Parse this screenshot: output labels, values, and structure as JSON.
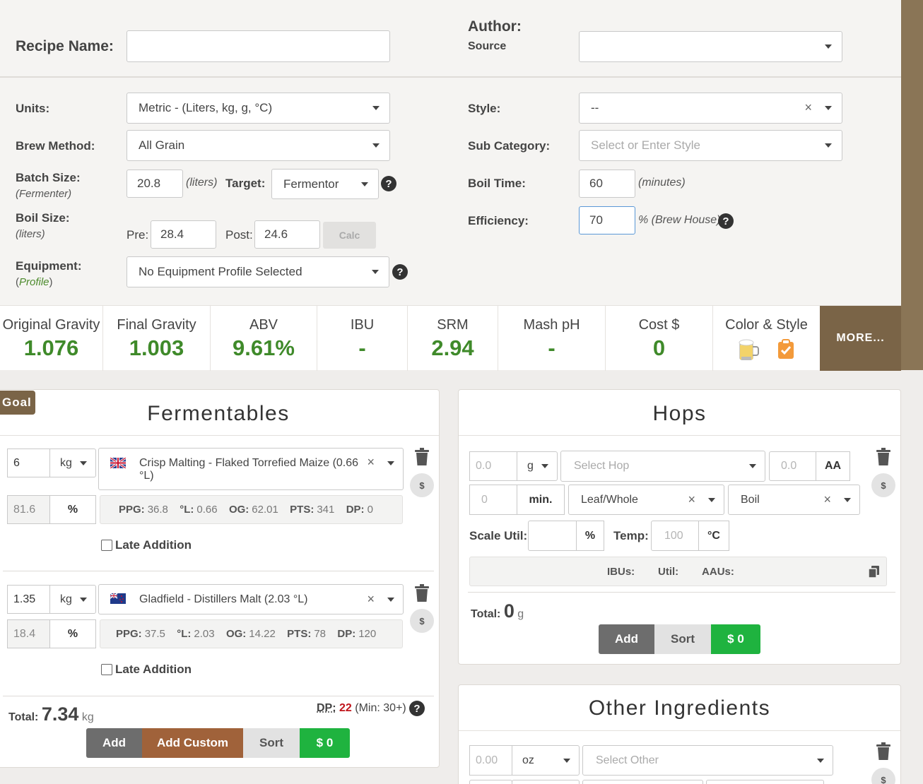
{
  "recipe": {
    "name_label": "Recipe Name:",
    "name_value": "",
    "author_label": "Author:",
    "source_label": "Source",
    "author_value": ""
  },
  "settings": {
    "units_label": "Units:",
    "units_value": "Metric - (Liters, kg, g, °C)",
    "brew_method_label": "Brew Method:",
    "brew_method_value": "All Grain",
    "batch_size_label": "Batch Size:",
    "batch_size_sub": "(Fermenter)",
    "batch_size_value": "20.8",
    "batch_size_unit": "(liters)",
    "target_label": "Target:",
    "target_value": "Fermentor",
    "boil_size_label": "Boil Size:",
    "boil_size_sub": "(liters)",
    "pre_label": "Pre:",
    "pre_value": "28.4",
    "post_label": "Post:",
    "post_value": "24.6",
    "calc_label": "Calc",
    "equipment_label": "Equipment:",
    "equipment_sub_open": "(",
    "equipment_sub_link": "Profile",
    "equipment_sub_close": ")",
    "equipment_value": "No Equipment Profile Selected",
    "style_label": "Style:",
    "style_value": "--",
    "subcat_label": "Sub Category:",
    "subcat_placeholder": "Select or Enter Style",
    "boil_time_label": "Boil Time:",
    "boil_time_value": "60",
    "boil_time_unit": "(minutes)",
    "efficiency_label": "Efficiency:",
    "efficiency_value": "70",
    "efficiency_unit": "% (Brew House)",
    "help_glyph": "?"
  },
  "stats": {
    "og_label": "Original Gravity",
    "og_value": "1.076",
    "fg_label": "Final Gravity",
    "fg_value": "1.003",
    "abv_label": "ABV",
    "abv_value": "9.61%",
    "ibu_label": "IBU",
    "ibu_value": "-",
    "srm_label": "SRM",
    "srm_value": "2.94",
    "ph_label": "Mash pH",
    "ph_value": "-",
    "cost_label": "Cost $",
    "cost_value": "0",
    "color_label": "Color & Style",
    "more_label": "MORE..."
  },
  "fermentables": {
    "goal_tab": "Goal",
    "title": "Fermentables",
    "items": [
      {
        "amount": "6",
        "unit": "kg",
        "name": "Crisp Malting - Flaked Torrefied Maize (0.66",
        "name_cont": "°L)",
        "flag": "uk",
        "pct": "81.6",
        "pct_sign": "%",
        "ppg_label": "PPG:",
        "ppg": "36.8",
        "l_label": "°L:",
        "l": "0.66",
        "og_label": "OG:",
        "og": "62.01",
        "pts_label": "PTS:",
        "pts": "341",
        "dp_label": "DP:",
        "dp": "0",
        "late_label": "Late Addition"
      },
      {
        "amount": "1.35",
        "unit": "kg",
        "name": "Gladfield - Distillers Malt (2.03 °L)",
        "name_cont": "",
        "flag": "nz",
        "pct": "18.4",
        "pct_sign": "%",
        "ppg_label": "PPG:",
        "ppg": "37.5",
        "l_label": "°L:",
        "l": "2.03",
        "og_label": "OG:",
        "og": "14.22",
        "pts_label": "PTS:",
        "pts": "78",
        "dp_label": "DP:",
        "dp": "120",
        "late_label": "Late Addition"
      }
    ],
    "total_label": "Total:",
    "total_value": "7.34",
    "total_unit": "kg",
    "dp_label": "DP:",
    "dp_value": "22",
    "dp_min": "(Min: 30+)",
    "add_label": "Add",
    "add_custom_label": "Add Custom",
    "sort_label": "Sort",
    "cost_label": "$ 0",
    "dollar_glyph": "$",
    "clear_glyph": "×"
  },
  "hops": {
    "title": "Hops",
    "amount_placeholder": "0.0",
    "amount_unit": "g",
    "hop_placeholder": "Select Hop",
    "aa_placeholder": "0.0",
    "aa_label": "AA",
    "time_placeholder": "0",
    "time_unit": "min.",
    "form_value": "Leaf/Whole",
    "use_value": "Boil",
    "scale_label": "Scale Util:",
    "scale_value": "",
    "scale_unit": "%",
    "temp_label": "Temp:",
    "temp_placeholder": "100",
    "temp_unit": "°C",
    "ibus_label": "IBUs:",
    "util_label": "Util:",
    "aaus_label": "AAUs:",
    "total_label": "Total:",
    "total_value": "0",
    "total_unit": "g",
    "add_label": "Add",
    "sort_label": "Sort",
    "cost_label": "$ 0"
  },
  "other": {
    "title": "Other Ingredients",
    "amount_placeholder": "0.00",
    "unit": "oz",
    "select_placeholder": "Select Other"
  },
  "colors": {
    "accent_brown": "#7a6447",
    "value_green": "#3f8a2a",
    "cost_green": "#1fb33f",
    "dp_red": "#c0141b"
  }
}
